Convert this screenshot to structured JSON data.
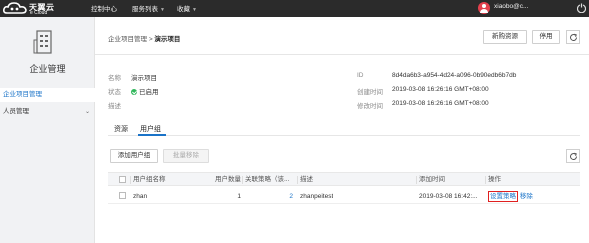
{
  "topbar": {
    "logo_cn": "天翼云",
    "logo_en": "e Cloud",
    "nav": [
      {
        "label": "控制中心",
        "has_caret": false
      },
      {
        "label": "服务列表",
        "has_caret": true
      },
      {
        "label": "收藏",
        "has_caret": true
      }
    ],
    "user_name": "xiaobo@c...",
    "accent_color": "#e4404d"
  },
  "sidebar": {
    "title": "企业管理",
    "items": [
      {
        "label": "企业项目管理",
        "active": true
      },
      {
        "label": "人员管理",
        "active": false,
        "expandable": true
      }
    ]
  },
  "header": {
    "breadcrumb_parent": "企业项目管理",
    "breadcrumb_sep": ">",
    "breadcrumb_current": "演示项目",
    "add_resource_label": "新购资源",
    "disable_label": "停用"
  },
  "info": {
    "name_label": "名称",
    "name_value": "演示项目",
    "status_label": "状态",
    "status_value": "已启用",
    "desc_label": "描述",
    "desc_value": "",
    "id_label": "ID",
    "id_value": "8d4da6b3-a954-4d24-a096-0b90edb6b7db",
    "created_label": "创建时间",
    "created_value": "2019-03-08 16:26:16 GMT+08:00",
    "modified_label": "修改时间",
    "modified_value": "2019-03-08 16:26:16 GMT+08:00"
  },
  "tabs": [
    {
      "label": "资源",
      "active": false
    },
    {
      "label": "用户组",
      "active": true
    }
  ],
  "toolbar": {
    "add_group_label": "添加用户组",
    "batch_remove_label": "批量移除"
  },
  "table": {
    "columns": [
      "用户组名称",
      "用户数量",
      "关联策略（该...",
      "描述",
      "添加时间",
      "操作"
    ],
    "rows": [
      {
        "name": "zhan",
        "user_count": "1",
        "policy_count": "2",
        "description": "zhanpeitest",
        "added_time": "2019-03-08 16:42:...",
        "action_set_policy": "设置策略",
        "action_remove": "移除"
      }
    ]
  }
}
